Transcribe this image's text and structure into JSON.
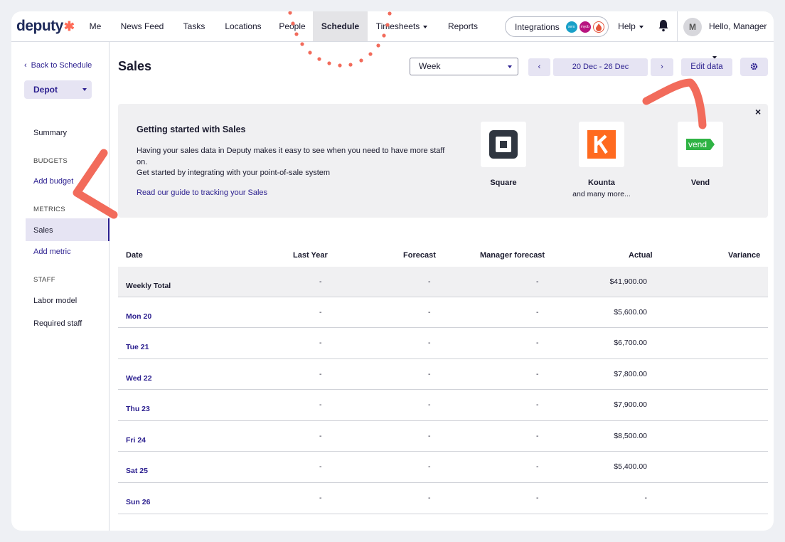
{
  "brand": {
    "name": "deputy",
    "accent": "#ff6b57",
    "primary": "#2b1f8f"
  },
  "nav": {
    "items": [
      {
        "label": "Me",
        "name": "nav-me"
      },
      {
        "label": "News Feed",
        "name": "nav-news-feed"
      },
      {
        "label": "Tasks",
        "name": "nav-tasks"
      },
      {
        "label": "Locations",
        "name": "nav-locations"
      },
      {
        "label": "People",
        "name": "nav-people"
      },
      {
        "label": "Schedule",
        "name": "nav-schedule"
      },
      {
        "label": "Timesheets",
        "name": "nav-timesheets"
      },
      {
        "label": "Reports",
        "name": "nav-reports"
      }
    ],
    "integrations_label": "Integrations",
    "help_label": "Help",
    "avatar_initial": "M",
    "greeting": "Hello, Manager"
  },
  "sidebar": {
    "back_label": "Back to Schedule",
    "location": "Depot",
    "summary": "Summary",
    "budgets_heading": "BUDGETS",
    "add_budget": "Add budget",
    "metrics_heading": "METRICS",
    "sales": "Sales",
    "add_metric": "Add metric",
    "staff_heading": "STAFF",
    "labor_model": "Labor model",
    "required_staff": "Required staff"
  },
  "page": {
    "title": "Sales",
    "period_select": "Week",
    "date_range": "20 Dec - 26 Dec",
    "prev": "‹",
    "next": "›",
    "edit_data": "Edit data"
  },
  "banner": {
    "title": "Getting started with Sales",
    "line1": "Having your sales data in Deputy makes it easy to see when you need to have more staff on.",
    "line2": "Get started by integrating with your point-of-sale system",
    "guide_link": "Read our guide to tracking your Sales",
    "close": "×",
    "pos": [
      {
        "name": "Square",
        "sub": "",
        "color": "#2f3640"
      },
      {
        "name": "Kounta",
        "sub": "and many more...",
        "color": "#ff6a1f"
      },
      {
        "name": "Vend",
        "sub": "",
        "color": "#2fb344",
        "logo_text": "vend"
      }
    ]
  },
  "table": {
    "columns": [
      "Date",
      "Last Year",
      "Forecast",
      "Manager forecast",
      "Actual",
      "Variance"
    ],
    "rows": [
      {
        "date": "Weekly Total",
        "last_year": "-",
        "forecast": "-",
        "manager": "-",
        "actual": "$41,900.00"
      },
      {
        "date": "Mon 20",
        "last_year": "-",
        "forecast": "-",
        "manager": "-",
        "actual": "$5,600.00"
      },
      {
        "date": "Tue 21",
        "last_year": "-",
        "forecast": "-",
        "manager": "-",
        "actual": "$6,700.00"
      },
      {
        "date": "Wed 22",
        "last_year": "-",
        "forecast": "-",
        "manager": "-",
        "actual": "$7,800.00"
      },
      {
        "date": "Thu 23",
        "last_year": "-",
        "forecast": "-",
        "manager": "-",
        "actual": "$7,900.00"
      },
      {
        "date": "Fri 24",
        "last_year": "-",
        "forecast": "-",
        "manager": "-",
        "actual": "$8,500.00"
      },
      {
        "date": "Sat 25",
        "last_year": "-",
        "forecast": "-",
        "manager": "-",
        "actual": "$5,400.00"
      },
      {
        "date": "Sun 26",
        "last_year": "-",
        "forecast": "-",
        "manager": "-",
        "actual": "-"
      }
    ]
  }
}
